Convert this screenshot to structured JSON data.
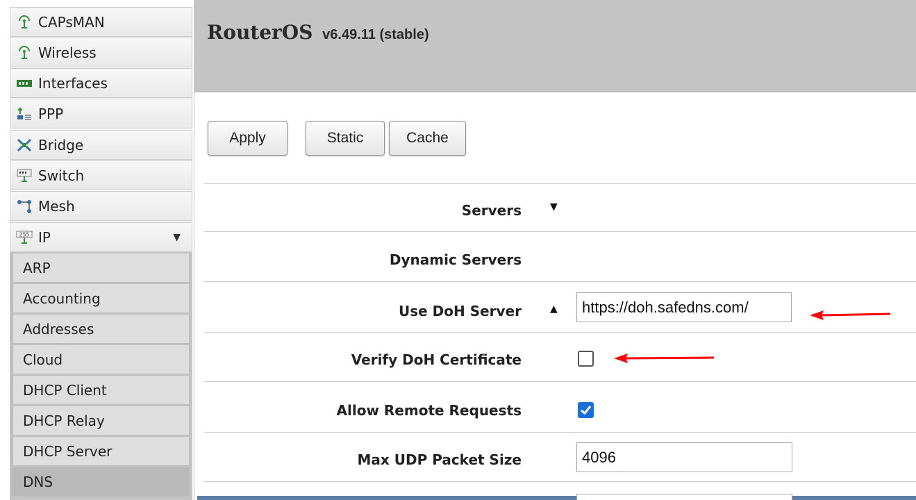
{
  "sidebar": {
    "items": [
      {
        "label": "CAPsMAN",
        "icon": "capsman-antenna-icon"
      },
      {
        "label": "Wireless",
        "icon": "wireless-antenna-icon"
      },
      {
        "label": "Interfaces",
        "icon": "interfaces-icon"
      },
      {
        "label": "PPP",
        "icon": "ppp-icon"
      },
      {
        "label": "Bridge",
        "icon": "bridge-icon"
      },
      {
        "label": "Switch",
        "icon": "switch-icon"
      },
      {
        "label": "Mesh",
        "icon": "mesh-icon"
      },
      {
        "label": "IP",
        "icon": "ip-icon",
        "expand_arrow": "▼"
      }
    ],
    "ip_submenu": [
      {
        "label": "ARP"
      },
      {
        "label": "Accounting"
      },
      {
        "label": "Addresses"
      },
      {
        "label": "Cloud"
      },
      {
        "label": "DHCP Client"
      },
      {
        "label": "DHCP Relay"
      },
      {
        "label": "DHCP Server"
      },
      {
        "label": "DNS",
        "active": true
      }
    ]
  },
  "header": {
    "product": "RouterOS",
    "version": "v6.49.11 (stable)"
  },
  "toolbar": {
    "apply_label": "Apply",
    "static_label": "Static",
    "cache_label": "Cache"
  },
  "form": {
    "servers": {
      "label": "Servers",
      "toggle": "▼"
    },
    "dynamic_servers": {
      "label": "Dynamic Servers"
    },
    "use_doh_server": {
      "label": "Use DoH Server",
      "toggle": "▲",
      "value": "https://doh.safedns.com/"
    },
    "verify_doh_certificate": {
      "label": "Verify DoH Certificate",
      "checked": false
    },
    "allow_remote_requests": {
      "label": "Allow Remote Requests",
      "checked": true
    },
    "max_udp_packet_size": {
      "label": "Max UDP Packet Size",
      "value": "4096"
    }
  },
  "colors": {
    "annotation_arrow": "#ff0000",
    "checkbox_checked": "#1a6ed8",
    "header_bg": "#c4c4c4"
  }
}
